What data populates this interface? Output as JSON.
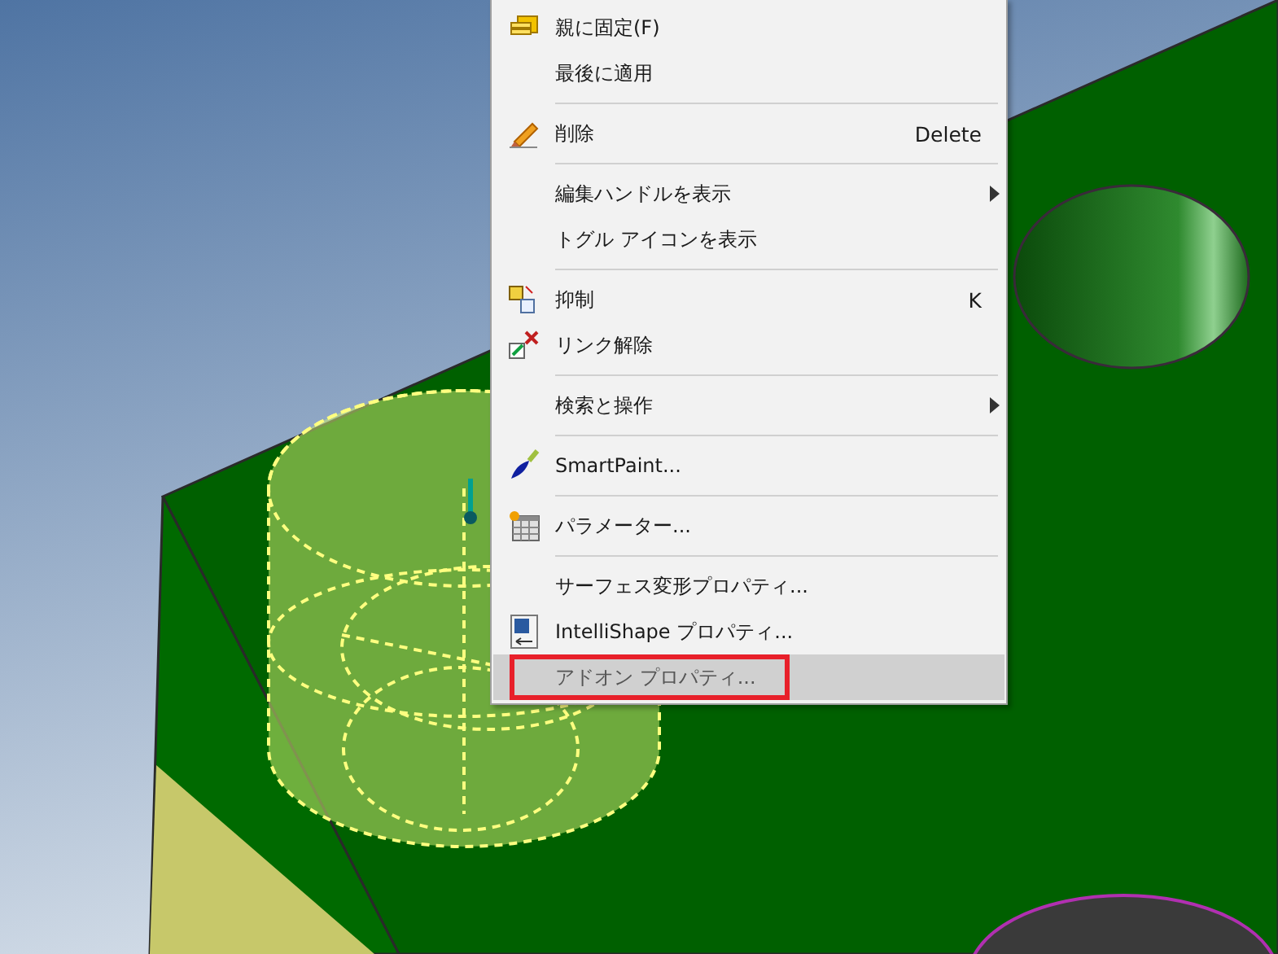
{
  "context_menu": {
    "items": [
      {
        "kind": "item",
        "label": "親に固定(F)",
        "selected": false,
        "annotated": false
      },
      {
        "kind": "item",
        "label": "最後に適用",
        "selected": false,
        "annotated": false
      },
      {
        "kind": "separator"
      },
      {
        "kind": "item",
        "label": "削除",
        "shortcut": "Delete",
        "selected": false,
        "annotated": false
      },
      {
        "kind": "separator"
      },
      {
        "kind": "item",
        "label": "編集ハンドルを表示",
        "submenu": true,
        "selected": false,
        "annotated": false
      },
      {
        "kind": "item",
        "label": "トグル アイコンを表示",
        "selected": false,
        "annotated": false
      },
      {
        "kind": "separator"
      },
      {
        "kind": "item",
        "label": "抑制",
        "shortcut": "K",
        "selected": false,
        "annotated": false
      },
      {
        "kind": "item",
        "label": "リンク解除",
        "selected": false,
        "annotated": false
      },
      {
        "kind": "separator"
      },
      {
        "kind": "item",
        "label": "検索と操作",
        "submenu": true,
        "selected": false,
        "annotated": false
      },
      {
        "kind": "separator"
      },
      {
        "kind": "item",
        "label": "SmartPaint...",
        "selected": false,
        "annotated": false
      },
      {
        "kind": "separator"
      },
      {
        "kind": "item",
        "label": "パラメーター...",
        "selected": false,
        "annotated": false
      },
      {
        "kind": "separator"
      },
      {
        "kind": "item",
        "label": "サーフェス変形プロパティ...",
        "selected": false,
        "annotated": false
      },
      {
        "kind": "item",
        "label": "IntelliShape プロパティ...",
        "selected": false,
        "annotated": false
      },
      {
        "kind": "item",
        "label": "アドオン プロパティ...",
        "selected": true,
        "annotated": true
      }
    ]
  }
}
